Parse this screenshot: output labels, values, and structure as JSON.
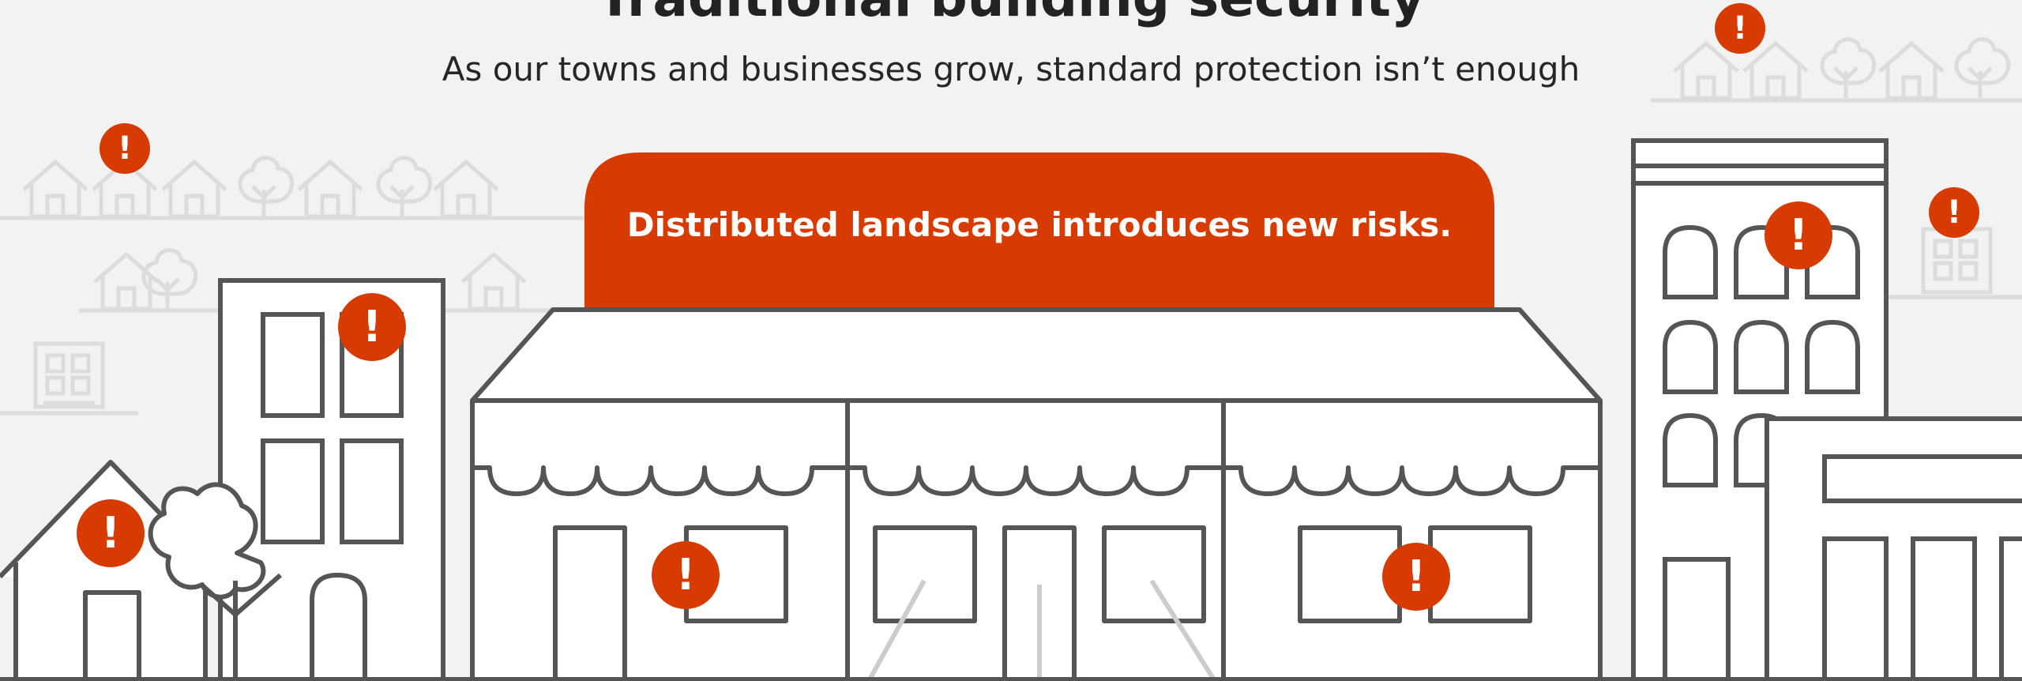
{
  "header": {
    "title": "Traditional building security",
    "subtitle": "As our towns and businesses grow, standard protection isn’t enough"
  },
  "banner": {
    "text": "Distributed landscape introduces new risks."
  },
  "alerts": {
    "glyph": "!",
    "icon": "exclamation-alert-icon",
    "count": 10
  },
  "colors": {
    "accent": "#d83b01",
    "outline": "#555555",
    "background": "#f2f2f2",
    "faint": "#dddddd"
  }
}
